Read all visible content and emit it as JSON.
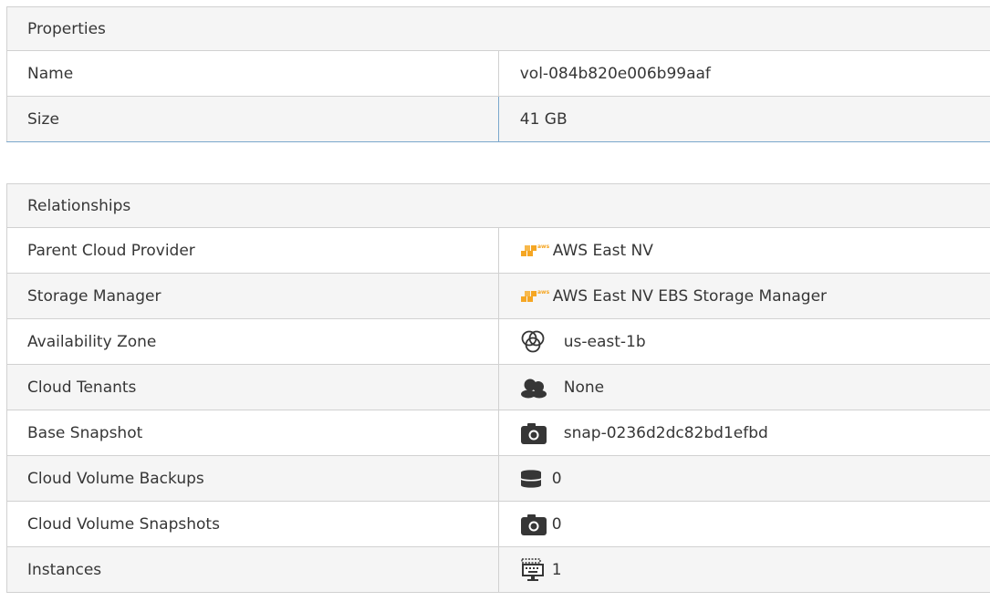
{
  "properties": {
    "title": "Properties",
    "rows": [
      {
        "label": "Name",
        "value": "vol-084b820e006b99aaf"
      },
      {
        "label": "Size",
        "value": "41 GB"
      }
    ]
  },
  "relationships": {
    "title": "Relationships",
    "rows": [
      {
        "label": "Parent Cloud Provider",
        "icon": "aws-provider-icon",
        "value": "AWS East NV"
      },
      {
        "label": "Storage Manager",
        "icon": "aws-provider-icon",
        "value": "AWS East NV EBS Storage Manager"
      },
      {
        "label": "Availability Zone",
        "icon": "availability-zone-icon",
        "value": "us-east-1b"
      },
      {
        "label": "Cloud Tenants",
        "icon": "cloud-tenant-icon",
        "value": "None"
      },
      {
        "label": "Base Snapshot",
        "icon": "camera-icon",
        "value": "snap-0236d2dc82bd1efbd"
      },
      {
        "label": "Cloud Volume Backups",
        "icon": "database-icon",
        "value": "0"
      },
      {
        "label": "Cloud Volume Snapshots",
        "icon": "camera-icon",
        "value": "0"
      },
      {
        "label": "Instances",
        "icon": "instance-monitor-icon",
        "value": "1"
      }
    ]
  },
  "colors": {
    "header_background": "#f5f5f5",
    "border": "#d1d1d1",
    "text": "#363636",
    "aws_orange": "#f5a623",
    "selected_border": "#7ba7cc"
  }
}
